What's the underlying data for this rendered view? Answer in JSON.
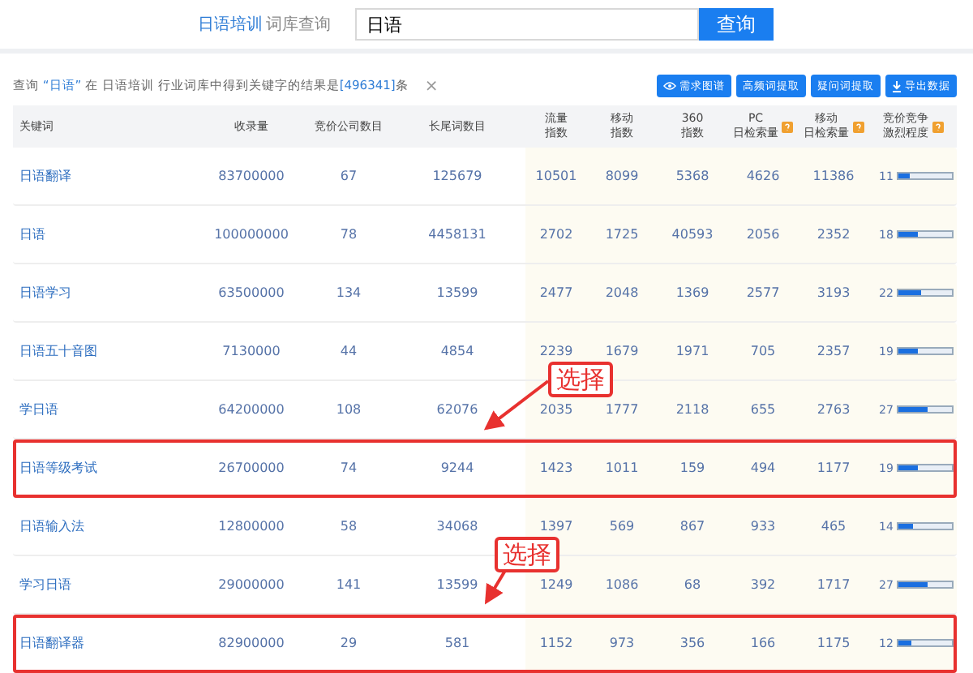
{
  "search": {
    "category": "日语培训",
    "label": "词库查询",
    "value": "日语",
    "button": "查询"
  },
  "query": {
    "parts": [
      {
        "kind": "plain",
        "text": "查询 "
      },
      {
        "kind": "link",
        "text": "“日语”"
      },
      {
        "kind": "plain",
        "text": " 在 日语培训 行业词库中得到关键字的结果是"
      },
      {
        "kind": "link",
        "text": "[496341]"
      },
      {
        "kind": "plain",
        "text": "条"
      }
    ],
    "close": "×"
  },
  "toolbar": [
    {
      "kind": "eye",
      "label": "需求图谱"
    },
    {
      "kind": "plain",
      "label": "高频词提取"
    },
    {
      "kind": "plain",
      "label": "疑问词提取"
    },
    {
      "kind": "download",
      "label": "导出数据"
    }
  ],
  "columns": [
    {
      "lines": [
        "关键词"
      ],
      "help": false
    },
    {
      "lines": [
        "收录量"
      ],
      "help": false
    },
    {
      "lines": [
        "竞价公司数目"
      ],
      "help": false
    },
    {
      "lines": [
        "长尾词数目"
      ],
      "help": false
    },
    {
      "lines": [
        "流量",
        "指数"
      ],
      "help": false
    },
    {
      "lines": [
        "移动",
        "指数"
      ],
      "help": false
    },
    {
      "lines": [
        "360",
        "指数"
      ],
      "help": false
    },
    {
      "lines": [
        "PC",
        "日检索量"
      ],
      "help": true
    },
    {
      "lines": [
        "移动",
        "日检索量"
      ],
      "help": true
    },
    {
      "lines": [
        "竞价竞争",
        "激烈程度"
      ],
      "help": true
    }
  ],
  "rows": [
    {
      "keyword": "日语翻译",
      "cells": [
        "83700000",
        "67",
        "125679",
        "10501",
        "8099",
        "5368",
        "4626",
        "11386"
      ],
      "competition": "11",
      "level": 0.22,
      "highlighted": false
    },
    {
      "keyword": "日语",
      "cells": [
        "100000000",
        "78",
        "4458131",
        "2702",
        "1725",
        "40593",
        "2056",
        "2352"
      ],
      "competition": "18",
      "level": 0.36,
      "highlighted": false
    },
    {
      "keyword": "日语学习",
      "cells": [
        "63500000",
        "134",
        "13599",
        "2477",
        "2048",
        "1369",
        "2577",
        "3193"
      ],
      "competition": "22",
      "level": 0.44,
      "highlighted": false
    },
    {
      "keyword": "日语五十音图",
      "cells": [
        "7130000",
        "44",
        "4854",
        "2239",
        "1679",
        "1971",
        "705",
        "2357"
      ],
      "competition": "19",
      "level": 0.38,
      "highlighted": false
    },
    {
      "keyword": "学日语",
      "cells": [
        "64200000",
        "108",
        "62076",
        "2035",
        "1777",
        "2118",
        "655",
        "2763"
      ],
      "competition": "27",
      "level": 0.54,
      "highlighted": false
    },
    {
      "keyword": "日语等级考试",
      "cells": [
        "26700000",
        "74",
        "9244",
        "1423",
        "1011",
        "159",
        "494",
        "1177"
      ],
      "competition": "19",
      "level": 0.38,
      "highlighted": true
    },
    {
      "keyword": "日语输入法",
      "cells": [
        "12800000",
        "58",
        "34068",
        "1397",
        "569",
        "867",
        "933",
        "465"
      ],
      "competition": "14",
      "level": 0.28,
      "highlighted": false
    },
    {
      "keyword": "学习日语",
      "cells": [
        "29000000",
        "141",
        "13599",
        "1249",
        "1086",
        "68",
        "392",
        "1717"
      ],
      "competition": "27",
      "level": 0.54,
      "highlighted": false
    },
    {
      "keyword": "日语翻译器",
      "cells": [
        "82900000",
        "29",
        "581",
        "1152",
        "973",
        "356",
        "166",
        "1175"
      ],
      "competition": "12",
      "level": 0.24,
      "highlighted": true
    }
  ],
  "annotations": [
    {
      "text": "选择"
    },
    {
      "text": "选择"
    }
  ]
}
